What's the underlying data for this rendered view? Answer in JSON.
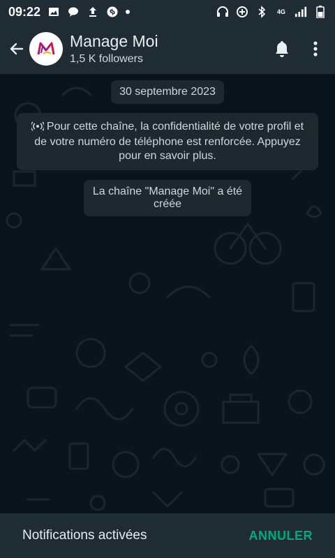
{
  "status_bar": {
    "time": "09:22",
    "network": "4G"
  },
  "header": {
    "channel_name": "Manage Moi",
    "followers": "1,5 K followers"
  },
  "chat": {
    "date": "30 septembre 2023",
    "privacy_notice": "Pour cette chaîne, la confidentialité de votre profil et de votre numéro de téléphone est renforcée. Appuyez pour en savoir plus.",
    "created_message": "La chaîne \"Manage Moi\" a été créée"
  },
  "bottom_bar": {
    "notification_text": "Notifications activées",
    "cancel_label": "ANNULER"
  },
  "colors": {
    "accent": "#00a884",
    "bar_background": "#1f2c34",
    "chat_background": "#0b141a"
  }
}
